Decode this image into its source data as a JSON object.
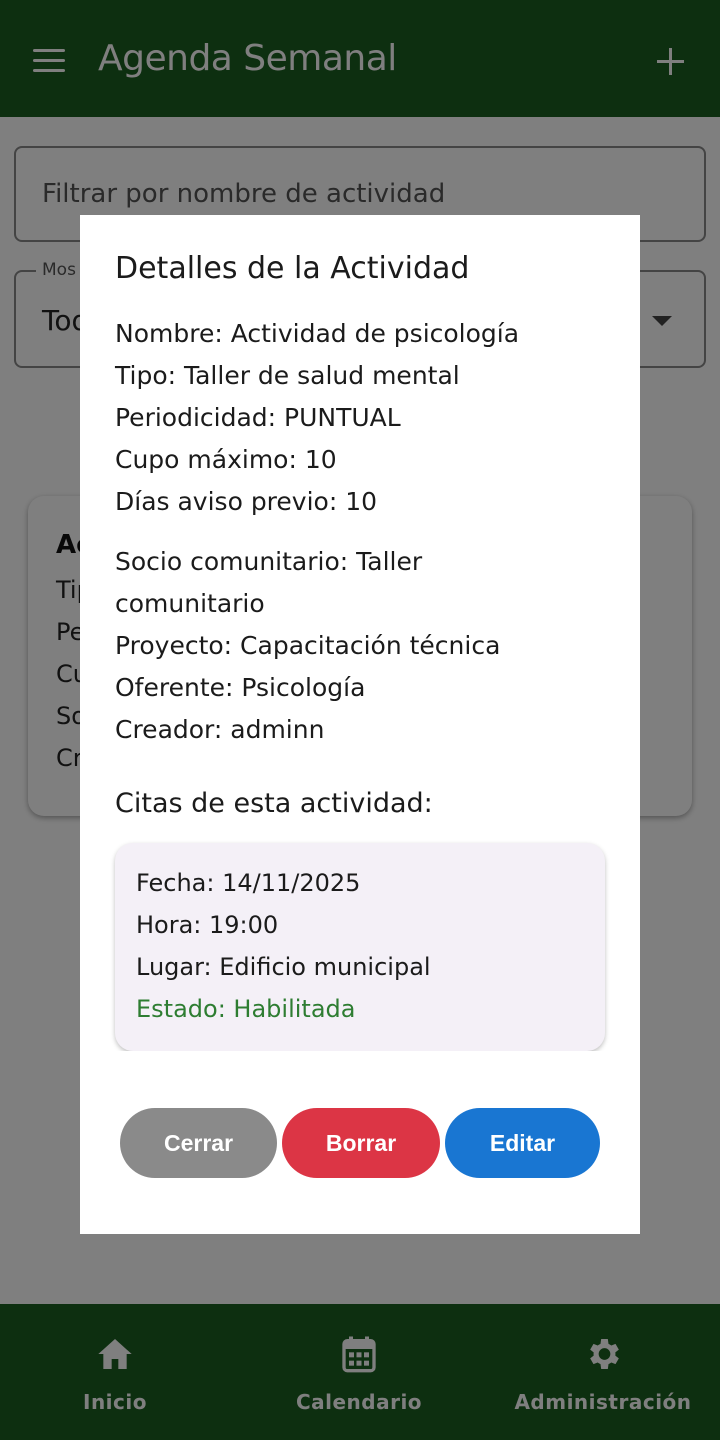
{
  "appbar": {
    "title": "Agenda Semanal",
    "menu_icon": "menu-icon",
    "add_icon": "plus-icon"
  },
  "filters": {
    "search_placeholder": "Filtrar por nombre de actividad",
    "select_label": "Mos",
    "select_value": "Tod"
  },
  "background_card": {
    "title": "Ac",
    "lines": [
      "Tip",
      "Pe",
      "Cu",
      "So",
      "Cr"
    ]
  },
  "dialog": {
    "title": "Detalles de la Actividad",
    "details": [
      "Nombre: Actividad de psicología",
      "Tipo: Taller de salud mental",
      "Periodicidad: PUNTUAL",
      "Cupo máximo: 10",
      "Días aviso previo: 10"
    ],
    "details2": [
      "Socio comunitario: Taller comunitario",
      "Proyecto: Capacitación técnica",
      "Oferente: Psicología",
      "Creador: adminn"
    ],
    "citas_title": "Citas de esta actividad:",
    "cita": {
      "fecha": "Fecha: 14/11/2025",
      "hora": "Hora: 19:00",
      "lugar": "Lugar: Edificio municipal",
      "estado": "Estado: Habilitada"
    },
    "buttons": {
      "close": "Cerrar",
      "delete": "Borrar",
      "edit": "Editar"
    }
  },
  "bottom_nav": [
    {
      "label": "Inicio",
      "icon": "home-icon"
    },
    {
      "label": "Calendario",
      "icon": "calendar-icon"
    },
    {
      "label": "Administración",
      "icon": "gear-icon"
    }
  ],
  "colors": {
    "primary": "#1b5e20",
    "status_enabled": "#2e7d32",
    "close_button": "#8a8a8a",
    "delete_button": "#dc3545",
    "edit_button": "#1976d2"
  }
}
